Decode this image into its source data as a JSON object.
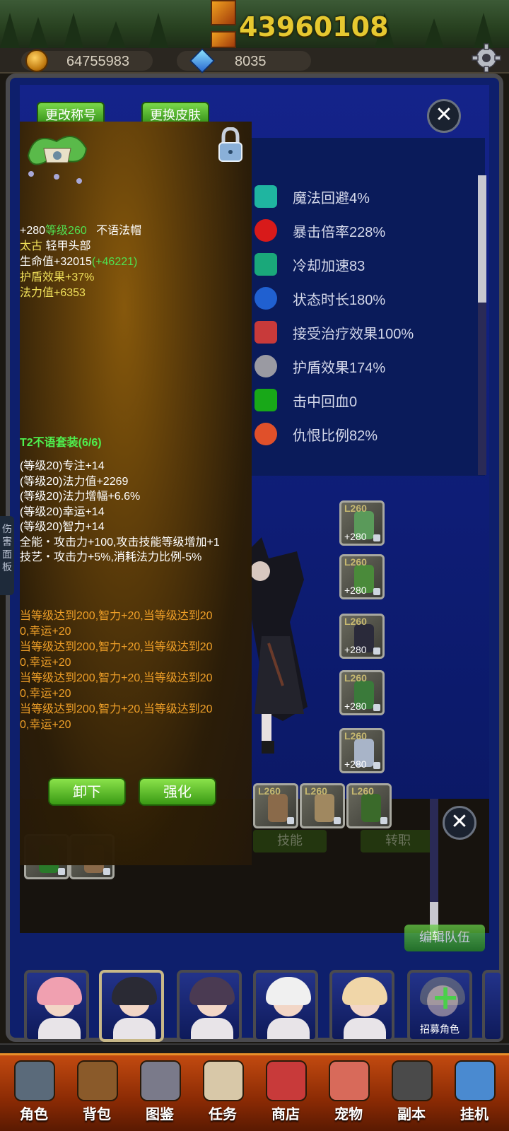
{
  "header": {
    "power_value": "43960108",
    "gold": "64755983",
    "gems": "8035"
  },
  "profile": {
    "rename_label": "更改称号",
    "skin_label": "更换皮肤"
  },
  "stats": [
    {
      "label": "魔法回避4%",
      "icon": "magic-dodge-icon",
      "color": "#1fb5a0"
    },
    {
      "label": "暴击倍率228%",
      "icon": "crit-multiplier-icon",
      "color": "#d81a1a"
    },
    {
      "label": "冷却加速83",
      "icon": "cooldown-icon",
      "color": "#1aa87a"
    },
    {
      "label": "状态时长180%",
      "icon": "status-duration-icon",
      "color": "#2060d0"
    },
    {
      "label": "接受治疗效果100%",
      "icon": "healing-received-icon",
      "color": "#c83a3a"
    },
    {
      "label": "护盾效果174%",
      "icon": "shield-effect-icon",
      "color": "#9a9aa2"
    },
    {
      "label": "击中回血0",
      "icon": "lifesteal-icon",
      "color": "#18a818"
    },
    {
      "label": "仇恨比例82%",
      "icon": "aggro-icon",
      "color": "#e0502a"
    }
  ],
  "equip_slots": [
    {
      "level": "L260",
      "plus": "+280",
      "art_color": "#5a9a5a"
    },
    {
      "level": "L260",
      "plus": "+280",
      "art_color": "#4a8a3a"
    },
    {
      "level": "L260",
      "plus": "+280",
      "art_color": "#2a2a3a"
    },
    {
      "level": "L260",
      "plus": "+280",
      "art_color": "#3a7a3a"
    },
    {
      "level": "L260",
      "plus": "+280",
      "art_color": "#a8b4c8"
    }
  ],
  "bag_slots": [
    {
      "level": "L260",
      "art_color": "#8a6a4a"
    },
    {
      "level": "L260",
      "art_color": "#a08860"
    },
    {
      "level": "L260",
      "art_color": "#3a6a2a"
    }
  ],
  "ghost_buttons": {
    "skills": "技能",
    "class_change": "转职",
    "edit_team": "编辑队伍"
  },
  "side_tab": "伤害面板",
  "tooltip": {
    "line1_prefix": "+280",
    "line1_level": "等级260",
    "line1_name": "不语法帽",
    "rarity": "太古",
    "type": "轻甲头部",
    "hp": "生命值+32015",
    "hp_bonus": "(+46221)",
    "shield": "护盾效果+37%",
    "mana": "法力值+6353",
    "set_title": "T2不语套装(6/6)",
    "set_lines": [
      "(等级20)专注+14",
      "(等级20)法力值+2269",
      "(等级20)法力增幅+6.6%",
      "(等级20)幸运+14",
      "(等级20)智力+14",
      "全能・攻击力+100,攻击技能等级增加+1",
      "技艺・攻击力+5%,消耗法力比例-5%"
    ],
    "special_lines": [
      "当等级达到200,智力+20,当等级达到20",
      "0,幸运+20",
      "当等级达到200,智力+20,当等级达到20",
      "0,幸运+20",
      "当等级达到200,智力+20,当等级达到20",
      "0,幸运+20",
      "当等级达到200,智力+20,当等级达到20",
      "0,幸运+20"
    ],
    "unequip_label": "卸下",
    "enhance_label": "强化"
  },
  "portraits": [
    {
      "hair": "#f0a0b0",
      "selected": false
    },
    {
      "hair": "#2a2a34",
      "selected": true
    },
    {
      "hair": "#4a3a52",
      "selected": false
    },
    {
      "hair": "#f0f0f0",
      "selected": false
    },
    {
      "hair": "#f0d6a8",
      "selected": false
    }
  ],
  "recruit_label": "招募角色",
  "nav": [
    {
      "label": "角色",
      "icon": "helmet-icon"
    },
    {
      "label": "背包",
      "icon": "backpack-icon"
    },
    {
      "label": "图鉴",
      "icon": "book-icon"
    },
    {
      "label": "任务",
      "icon": "scroll-icon"
    },
    {
      "label": "商店",
      "icon": "shop-icon"
    },
    {
      "label": "宠物",
      "icon": "meat-icon"
    },
    {
      "label": "副本",
      "icon": "skull-icon"
    },
    {
      "label": "挂机",
      "icon": "calendar-icon"
    }
  ]
}
